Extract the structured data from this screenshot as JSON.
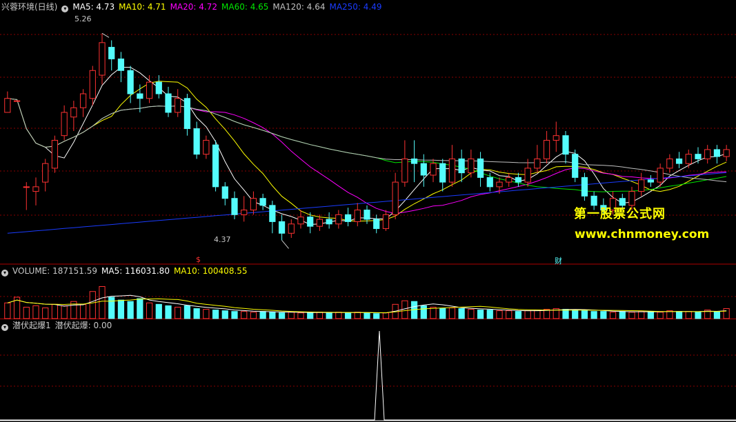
{
  "main_header": {
    "title": "兴蓉环境(日线)",
    "ma5": "MA5: 4.73",
    "ma10": "MA10: 4.71",
    "ma20": "MA20: 4.72",
    "ma60": "MA60: 4.65",
    "ma120": "MA120: 4.64",
    "ma250": "MA250: 4.49"
  },
  "volume_header": {
    "volume": "VOLUME: 187151.59",
    "ma5": "MA5: 116031.80",
    "ma10": "MA10: 100408.55"
  },
  "indicator_header": {
    "name": "潜伏起爆1",
    "value": "潜伏起爆: 0.00"
  },
  "price_marks": {
    "high": "5.26",
    "low": "4.37"
  },
  "event_marks": {
    "e1": "$",
    "e2": "财"
  },
  "watermark": {
    "line1": "第一股票公式网",
    "line2": "www.chnmoney.com"
  },
  "colors": {
    "up": "#ff3232",
    "down": "#54fcfc",
    "ma5": "#ffffff",
    "ma10": "#ffff00",
    "ma20": "#ff00ff",
    "ma60": "#00e600",
    "ma120": "#c0c0c0",
    "ma250": "#1a3cff",
    "grid": "#8b0000",
    "separator": "#b00000"
  },
  "chart_data": {
    "type": "candlestick",
    "price_ylim": [
      4.3,
      5.35
    ],
    "candles": [
      [
        4.92,
        4.98,
        4.95,
        5.01
      ],
      [
        4.97,
        4.97,
        4.6,
        4.6
      ],
      [
        4.6,
        4.6,
        4.5,
        4.62
      ],
      [
        4.58,
        4.6,
        4.52,
        4.64
      ],
      [
        4.62,
        4.7,
        4.58,
        4.72
      ],
      [
        4.68,
        4.8,
        4.66,
        4.82
      ],
      [
        4.82,
        4.92,
        4.8,
        4.95
      ],
      [
        4.9,
        4.94,
        4.84,
        4.97
      ],
      [
        4.94,
        5.0,
        4.9,
        5.02
      ],
      [
        4.98,
        5.1,
        4.95,
        5.12
      ],
      [
        5.08,
        5.22,
        5.04,
        5.26
      ],
      [
        5.2,
        5.15,
        5.1,
        5.23
      ],
      [
        5.15,
        5.1,
        5.05,
        5.18
      ],
      [
        5.1,
        5.0,
        4.96,
        5.12
      ],
      [
        5.0,
        4.98,
        4.92,
        5.04
      ],
      [
        4.98,
        5.05,
        4.96,
        5.08
      ],
      [
        5.05,
        5.0,
        4.98,
        5.08
      ],
      [
        5.0,
        4.92,
        4.9,
        5.03
      ],
      [
        4.92,
        4.98,
        4.9,
        5.02
      ],
      [
        4.98,
        4.85,
        4.82,
        5.0
      ],
      [
        4.85,
        4.74,
        4.72,
        4.88
      ],
      [
        4.74,
        4.8,
        4.72,
        4.82
      ],
      [
        4.78,
        4.6,
        4.58,
        4.8
      ],
      [
        4.6,
        4.55,
        4.52,
        4.62
      ],
      [
        4.55,
        4.48,
        4.46,
        4.58
      ],
      [
        4.48,
        4.5,
        4.45,
        4.56
      ],
      [
        4.5,
        4.55,
        4.48,
        4.58
      ],
      [
        4.55,
        4.52,
        4.5,
        4.57
      ],
      [
        4.52,
        4.45,
        4.4,
        4.54
      ],
      [
        4.45,
        4.4,
        4.37,
        4.48
      ],
      [
        4.4,
        4.44,
        4.38,
        4.46
      ],
      [
        4.44,
        4.47,
        4.42,
        4.5
      ],
      [
        4.47,
        4.43,
        4.4,
        4.49
      ],
      [
        4.43,
        4.46,
        4.41,
        4.48
      ],
      [
        4.46,
        4.44,
        4.42,
        4.49
      ],
      [
        4.44,
        4.48,
        4.42,
        4.5
      ],
      [
        4.48,
        4.45,
        4.43,
        4.51
      ],
      [
        4.45,
        4.5,
        4.43,
        4.53
      ],
      [
        4.5,
        4.46,
        4.44,
        4.52
      ],
      [
        4.46,
        4.42,
        4.4,
        4.48
      ],
      [
        4.42,
        4.48,
        4.41,
        4.5
      ],
      [
        4.48,
        4.62,
        4.46,
        4.66
      ],
      [
        4.62,
        4.72,
        4.6,
        4.8
      ],
      [
        4.72,
        4.7,
        4.62,
        4.8
      ],
      [
        4.7,
        4.65,
        4.6,
        4.74
      ],
      [
        4.65,
        4.7,
        4.62,
        4.72
      ],
      [
        4.7,
        4.62,
        4.58,
        4.72
      ],
      [
        4.62,
        4.72,
        4.6,
        4.78
      ],
      [
        4.72,
        4.66,
        4.62,
        4.76
      ],
      [
        4.66,
        4.72,
        4.64,
        4.76
      ],
      [
        4.72,
        4.64,
        4.6,
        4.75
      ],
      [
        4.64,
        4.6,
        4.58,
        4.66
      ],
      [
        4.6,
        4.62,
        4.57,
        4.64
      ],
      [
        4.62,
        4.64,
        4.6,
        4.66
      ],
      [
        4.64,
        4.62,
        4.6,
        4.66
      ],
      [
        4.62,
        4.68,
        4.6,
        4.72
      ],
      [
        4.68,
        4.72,
        4.66,
        4.78
      ],
      [
        4.72,
        4.8,
        4.7,
        4.84
      ],
      [
        4.8,
        4.82,
        4.75,
        4.88
      ],
      [
        4.82,
        4.74,
        4.7,
        4.84
      ],
      [
        4.74,
        4.64,
        4.62,
        4.76
      ],
      [
        4.64,
        4.56,
        4.54,
        4.66
      ],
      [
        4.56,
        4.52,
        4.5,
        4.58
      ],
      [
        4.52,
        4.5,
        4.48,
        4.55
      ],
      [
        4.5,
        4.55,
        4.48,
        4.58
      ],
      [
        4.55,
        4.52,
        4.5,
        4.57
      ],
      [
        4.52,
        4.58,
        4.5,
        4.6
      ],
      [
        4.58,
        4.63,
        4.56,
        4.66
      ],
      [
        4.63,
        4.62,
        4.6,
        4.65
      ],
      [
        4.62,
        4.68,
        4.6,
        4.7
      ],
      [
        4.68,
        4.72,
        4.66,
        4.74
      ],
      [
        4.72,
        4.7,
        4.68,
        4.75
      ],
      [
        4.7,
        4.74,
        4.68,
        4.76
      ],
      [
        4.74,
        4.72,
        4.7,
        4.77
      ],
      [
        4.72,
        4.76,
        4.7,
        4.78
      ],
      [
        4.76,
        4.73,
        4.7,
        4.78
      ],
      [
        4.73,
        4.76,
        4.71,
        4.78
      ]
    ],
    "volume_ylim": [
      0,
      60
    ],
    "volume": [
      22,
      30,
      16,
      18,
      15,
      20,
      18,
      24,
      20,
      38,
      45,
      30,
      26,
      24,
      28,
      22,
      20,
      18,
      16,
      18,
      14,
      13,
      12,
      11,
      10,
      10,
      9,
      10,
      9,
      8,
      9,
      8,
      8,
      9,
      8,
      9,
      8,
      9,
      8,
      7,
      8,
      20,
      25,
      24,
      18,
      16,
      14,
      15,
      14,
      13,
      12,
      12,
      11,
      11,
      10,
      11,
      12,
      13,
      14,
      13,
      12,
      11,
      10,
      10,
      9,
      10,
      9,
      10,
      10,
      9,
      11,
      10,
      10,
      9,
      12,
      10,
      14
    ],
    "indicator_ylim": [
      0,
      1
    ],
    "indicator_spike_index": 45,
    "indicator_spike_value": 1
  }
}
